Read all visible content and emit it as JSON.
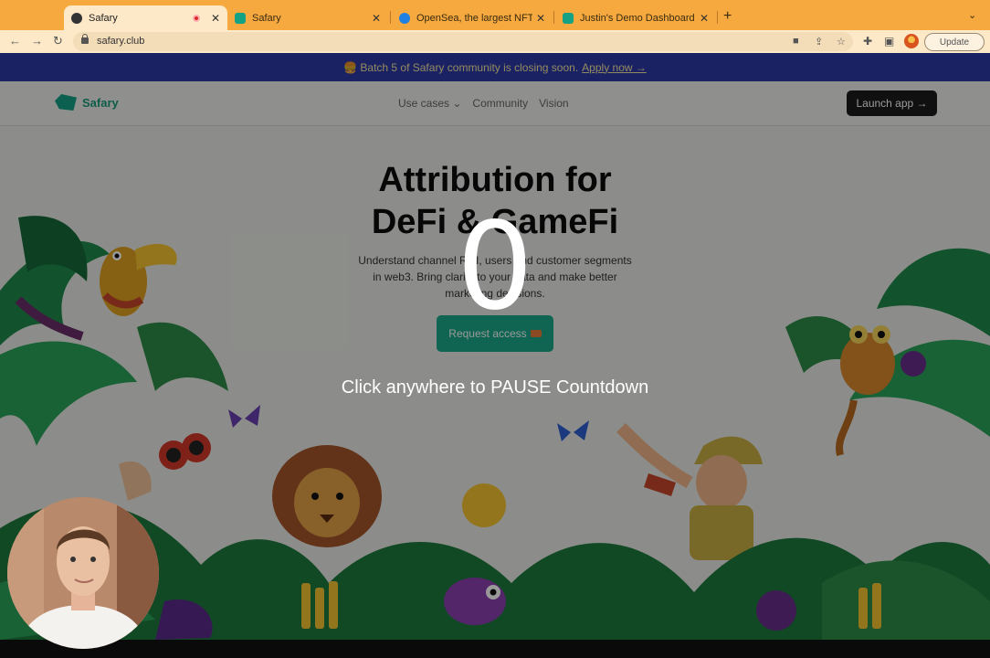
{
  "browser": {
    "tabs": [
      {
        "title": "Safary",
        "favicon_color": "#333333",
        "recording": true
      },
      {
        "title": "Safary",
        "favicon_color": "#14a184",
        "recording": false
      },
      {
        "title": "OpenSea, the largest NFT mar",
        "favicon_color": "#2081e2",
        "recording": false
      },
      {
        "title": "Justin's Demo Dashboard [Dem",
        "favicon_color": "#14a184",
        "recording": false
      }
    ],
    "new_tab_label": "+",
    "url": "safary.club",
    "update_label": "Update"
  },
  "site": {
    "banner": {
      "text": "🍔 Batch 5 of Safary community is closing soon.",
      "link": "Apply now →"
    },
    "logo_text": "Safary",
    "nav": {
      "use_cases": "Use cases ⌄",
      "community": "Community",
      "vision": "Vision",
      "launch": "Launch app →"
    },
    "hero": {
      "title_line1": "Attribution for",
      "title_line2": "DeFi & GameFi",
      "subtitle_line1": "Understand channel ROI, users and customer segments",
      "subtitle_line2": "in web3. Bring clarity to your data and make better",
      "subtitle_line3": "marketing decisions.",
      "cta": "Request access"
    }
  },
  "overlay": {
    "countdown": "0",
    "hint": "Click anywhere to PAUSE Countdown"
  },
  "colors": {
    "tabstrip": "#f6a93e",
    "toolbar": "#fde9c8",
    "banner": "#2d3aa6",
    "brand": "#14a184"
  }
}
